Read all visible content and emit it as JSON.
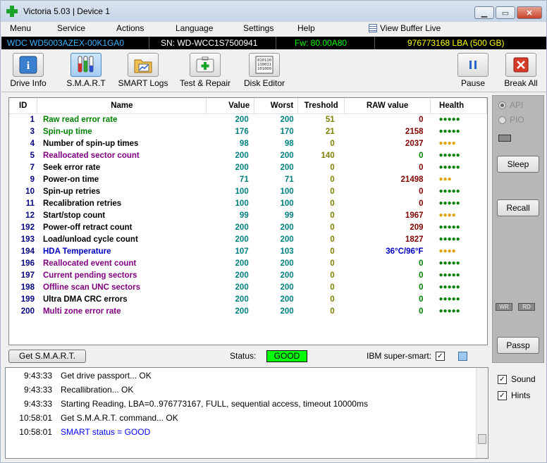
{
  "window": {
    "title": "Victoria 5.03 | Device 1",
    "minimize": "▁",
    "maximize": "▭",
    "close": "✕"
  },
  "menu": {
    "items": [
      "Menu",
      "Service",
      "Actions",
      "Language",
      "Settings",
      "Help"
    ],
    "view_buffer": "View Buffer Live"
  },
  "device": {
    "model": "WDC WD5003AZEX-00K1GA0",
    "serial": "SN: WD-WCC1S7500941",
    "firmware": "Fw: 80.00A80",
    "capacity": "976773168 LBA (500 GB)"
  },
  "toolbar": {
    "drive_info": "Drive Info",
    "smart": "S.M.A.R.T",
    "smart_logs": "SMART Logs",
    "test_repair": "Test & Repair",
    "disk_editor": "Disk Editor",
    "pause": "Pause",
    "break_all": "Break All"
  },
  "table": {
    "headers": [
      "ID",
      "Name",
      "Value",
      "Worst",
      "Treshold",
      "RAW value",
      "Health"
    ],
    "rows": [
      {
        "id": "1",
        "name": "Raw read error rate",
        "value": "200",
        "worst": "200",
        "thr": "51",
        "raw": "0",
        "health": "●●●●●",
        "name_color": "#008000",
        "thr_color": "#808000",
        "raw_color": "#800000",
        "health_color": "#008000"
      },
      {
        "id": "3",
        "name": "Spin-up time",
        "value": "176",
        "worst": "170",
        "thr": "21",
        "raw": "2158",
        "health": "●●●●●",
        "name_color": "#008000",
        "thr_color": "#808000",
        "raw_color": "#800000",
        "health_color": "#008000"
      },
      {
        "id": "4",
        "name": "Number of spin-up times",
        "value": "98",
        "worst": "98",
        "thr": "0",
        "raw": "2037",
        "health": "●●●●",
        "name_color": "#000000",
        "thr_color": "#808000",
        "raw_color": "#800000",
        "health_color": "#e0a000"
      },
      {
        "id": "5",
        "name": "Reallocated sector count",
        "value": "200",
        "worst": "200",
        "thr": "140",
        "raw": "0",
        "health": "●●●●●",
        "name_color": "#800080",
        "thr_color": "#808000",
        "raw_color": "#008000",
        "health_color": "#008000"
      },
      {
        "id": "7",
        "name": "Seek error rate",
        "value": "200",
        "worst": "200",
        "thr": "0",
        "raw": "0",
        "health": "●●●●●",
        "name_color": "#000000",
        "thr_color": "#808000",
        "raw_color": "#800000",
        "health_color": "#008000"
      },
      {
        "id": "9",
        "name": "Power-on time",
        "value": "71",
        "worst": "71",
        "thr": "0",
        "raw": "21498",
        "health": "●●●",
        "name_color": "#000000",
        "thr_color": "#808000",
        "raw_color": "#800000",
        "health_color": "#e0a000"
      },
      {
        "id": "10",
        "name": "Spin-up retries",
        "value": "100",
        "worst": "100",
        "thr": "0",
        "raw": "0",
        "health": "●●●●●",
        "name_color": "#000000",
        "thr_color": "#808000",
        "raw_color": "#800000",
        "health_color": "#008000"
      },
      {
        "id": "11",
        "name": "Recalibration retries",
        "value": "100",
        "worst": "100",
        "thr": "0",
        "raw": "0",
        "health": "●●●●●",
        "name_color": "#000000",
        "thr_color": "#808000",
        "raw_color": "#800000",
        "health_color": "#008000"
      },
      {
        "id": "12",
        "name": "Start/stop count",
        "value": "99",
        "worst": "99",
        "thr": "0",
        "raw": "1967",
        "health": "●●●●",
        "name_color": "#000000",
        "thr_color": "#808000",
        "raw_color": "#800000",
        "health_color": "#e0a000"
      },
      {
        "id": "192",
        "name": "Power-off retract count",
        "value": "200",
        "worst": "200",
        "thr": "0",
        "raw": "209",
        "health": "●●●●●",
        "name_color": "#000000",
        "thr_color": "#808000",
        "raw_color": "#800000",
        "health_color": "#008000"
      },
      {
        "id": "193",
        "name": "Load/unload cycle count",
        "value": "200",
        "worst": "200",
        "thr": "0",
        "raw": "1827",
        "health": "●●●●●",
        "name_color": "#000000",
        "thr_color": "#808000",
        "raw_color": "#800000",
        "health_color": "#008000"
      },
      {
        "id": "194",
        "name": "HDA Temperature",
        "value": "107",
        "worst": "103",
        "thr": "0",
        "raw": "36°C/96°F",
        "health": "●●●●",
        "name_color": "#0000c0",
        "thr_color": "#808000",
        "raw_color": "#0000c0",
        "health_color": "#e0a000"
      },
      {
        "id": "196",
        "name": "Reallocated event count",
        "value": "200",
        "worst": "200",
        "thr": "0",
        "raw": "0",
        "health": "●●●●●",
        "name_color": "#800080",
        "thr_color": "#808000",
        "raw_color": "#008000",
        "health_color": "#008000"
      },
      {
        "id": "197",
        "name": "Current pending sectors",
        "value": "200",
        "worst": "200",
        "thr": "0",
        "raw": "0",
        "health": "●●●●●",
        "name_color": "#800080",
        "thr_color": "#808000",
        "raw_color": "#008000",
        "health_color": "#008000"
      },
      {
        "id": "198",
        "name": "Offline scan UNC sectors",
        "value": "200",
        "worst": "200",
        "thr": "0",
        "raw": "0",
        "health": "●●●●●",
        "name_color": "#800080",
        "thr_color": "#808000",
        "raw_color": "#008000",
        "health_color": "#008000"
      },
      {
        "id": "199",
        "name": "Ultra DMA CRC errors",
        "value": "200",
        "worst": "200",
        "thr": "0",
        "raw": "0",
        "health": "●●●●●",
        "name_color": "#000000",
        "thr_color": "#808000",
        "raw_color": "#008000",
        "health_color": "#008000"
      },
      {
        "id": "200",
        "name": "Multi zone error rate",
        "value": "200",
        "worst": "200",
        "thr": "0",
        "raw": "0",
        "health": "●●●●●",
        "name_color": "#800080",
        "thr_color": "#808000",
        "raw_color": "#008000",
        "health_color": "#008000"
      }
    ]
  },
  "bottom": {
    "get_smart": "Get S.M.A.R.T.",
    "status_label": "Status:",
    "status_value": "GOOD",
    "ibm_label": "IBM super-smart:",
    "ibm_checked": "✓"
  },
  "right": {
    "api": "API",
    "pio": "PIO",
    "sleep": "Sleep",
    "recall": "Recall",
    "wr": "WR",
    "rd": "RD",
    "passp": "Passp"
  },
  "log": [
    {
      "time": "9:43:33",
      "msg": "Get drive passport... OK",
      "color": "#000000"
    },
    {
      "time": "9:43:33",
      "msg": "Recallibration... OK",
      "color": "#000000"
    },
    {
      "time": "9:43:33",
      "msg": "Starting Reading, LBA=0..976773167, FULL, sequential access, timeout 10000ms",
      "color": "#000000"
    },
    {
      "time": "10:58:01",
      "msg": "Get S.M.A.R.T. command... OK",
      "color": "#000000"
    },
    {
      "time": "10:58:01",
      "msg": "SMART status = GOOD",
      "color": "#0000ff"
    }
  ],
  "options": {
    "sound": "Sound",
    "hints": "Hints",
    "sound_checked": "✓",
    "hints_checked": "✓"
  }
}
